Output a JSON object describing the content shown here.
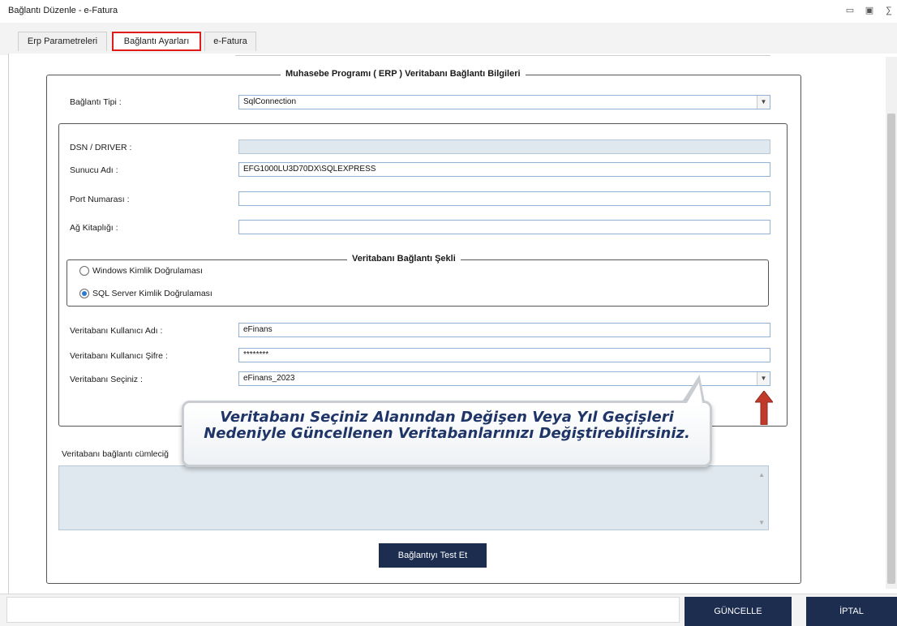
{
  "window": {
    "title": "Bağlantı Düzenle - e-Fatura"
  },
  "tabs": [
    {
      "label": "Erp Parametreleri",
      "active": false
    },
    {
      "label": "Bağlantı Ayarları",
      "active": true
    },
    {
      "label": "e-Fatura",
      "active": false
    }
  ],
  "erp_group": {
    "legend": "Muhasebe Programı ( ERP ) Veritabanı Bağlantı Bilgileri",
    "connection_type_label": "Bağlantı Tipi :",
    "connection_type_value": "SqlConnection",
    "dsn_label": "DSN / DRIVER :",
    "dsn_value": "",
    "server_label": "Sunucu Adı :",
    "server_value": "EFG1000LU3D70DX\\SQLEXPRESS",
    "port_label": "Port Numarası :",
    "port_value": "",
    "library_label": "Ağ Kitaplığı :",
    "library_value": ""
  },
  "auth_group": {
    "legend": "Veritabanı Bağlantı Şekli",
    "windows_auth_label": "Windows Kimlik Doğrulaması",
    "sql_auth_label": "SQL Server Kimlik Doğrulaması",
    "selected": "sql"
  },
  "credentials": {
    "user_label": "Veritabanı Kullanıcı Adı :",
    "user_value": "eFinans",
    "password_label": "Veritabanı Kullanıcı Şifre :",
    "password_value": "********",
    "database_label": "Veritabanı Seçiniz :",
    "database_value": "eFinans_2023"
  },
  "connection_string": {
    "label": "Veritabanı bağlantı cümleciğ",
    "value": ""
  },
  "buttons": {
    "test_connection": "Bağlantıyı Test Et",
    "update": "GÜNCELLE",
    "cancel": "İPTAL"
  },
  "callout": {
    "line1": "Veritabanı Seçiniz Alanından Değişen Veya Yıl Geçişleri",
    "line2": "Nedeniyle Güncellenen Veritabanlarınızı Değiştirebilirsiniz."
  },
  "colors": {
    "active_tab_border": "#e11a1a",
    "dark_button": "#1c2d4f",
    "callout_text": "#1f3567",
    "arrow": "#c0392b"
  }
}
